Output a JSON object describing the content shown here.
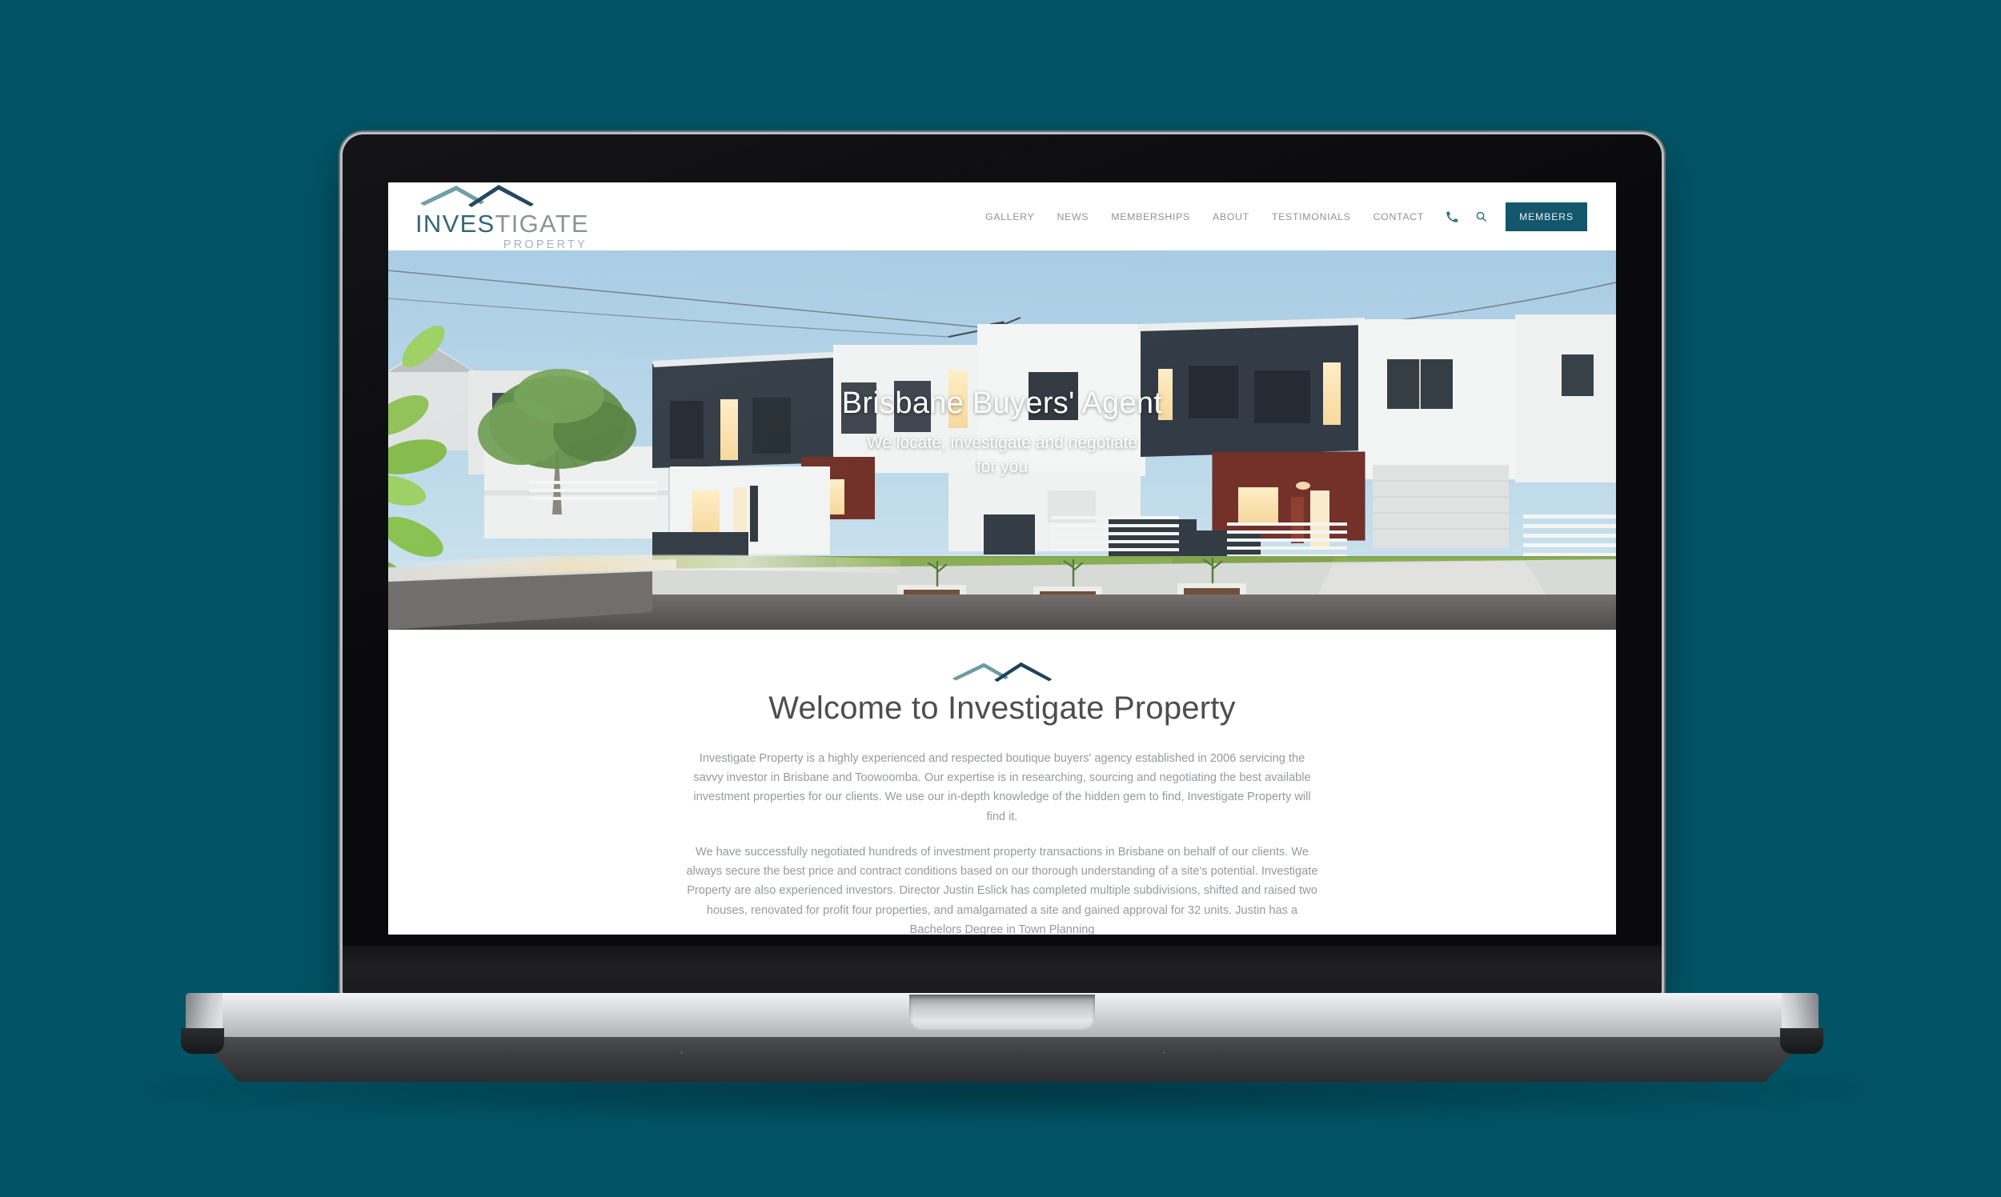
{
  "background_color": "#025365",
  "site": {
    "header": {
      "logo": {
        "wordmark_part1": "INVES",
        "wordmark_part2": "TIGATE",
        "subtitle": "PROPERTY",
        "mark_color_left": "#6d9aa4",
        "mark_color_right": "#1e4257"
      },
      "nav_items": [
        {
          "label": "GALLERY"
        },
        {
          "label": "NEWS"
        },
        {
          "label": "MEMBERSHIPS"
        },
        {
          "label": "ABOUT"
        },
        {
          "label": "TESTIMONIALS"
        },
        {
          "label": "CONTACT"
        }
      ],
      "phone_icon": "phone-icon",
      "search_icon": "search-icon",
      "members_button": {
        "label": "MEMBERS",
        "background": "#14566c",
        "text_color": "#eaf1f3"
      }
    },
    "hero": {
      "title": "Brisbane Buyers' Agent",
      "subtitle": "We locate, investigate and negotiate for you",
      "image_alt": "modern two-storey townhouses at dusk with lit windows"
    },
    "welcome": {
      "divider_icon": "mountain-divider-icon",
      "heading": "Welcome to Investigate Property",
      "paragraph_1": "Investigate Property is a highly experienced and respected boutique buyers' agency established in 2006 servicing the savvy investor in Brisbane and Toowoomba. Our expertise is in researching, sourcing and negotiating the best available investment properties for our clients. We use our in-depth knowledge of the hidden gem to find, Investigate Property will find it.",
      "paragraph_2": "We have successfully negotiated hundreds of investment property transactions in Brisbane on behalf of our clients. We always secure the best price and contract conditions based on our thorough understanding of a site's potential. Investigate Property are also experienced investors. Director Justin Eslick has completed multiple subdivisions, shifted and raised two houses, renovated for profit four properties, and amalgamated a site and gained approval for 32 units. Justin has a Bachelors Degree in Town Planning"
    }
  }
}
